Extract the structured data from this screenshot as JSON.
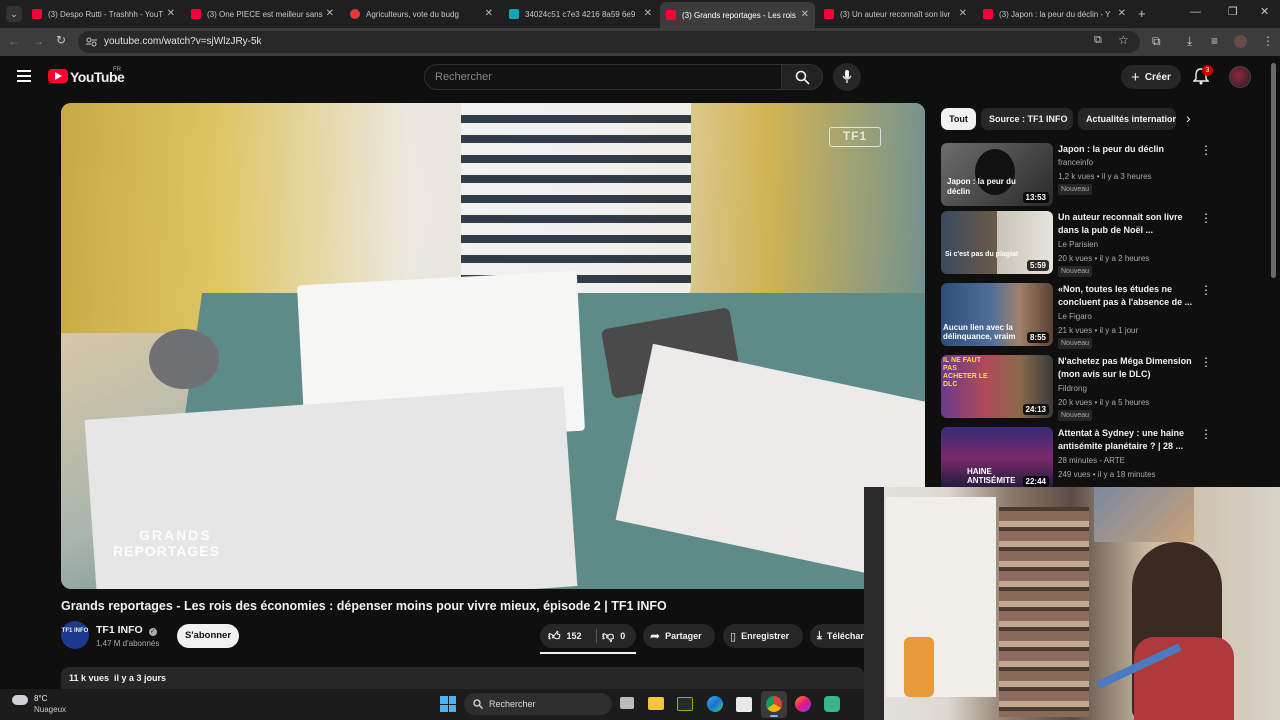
{
  "browser": {
    "tabs": [
      {
        "label": "(3) Despo Rutti - Trashhh - YouT",
        "active": false
      },
      {
        "label": "(3) One PIECE est meilleur sans",
        "active": false
      },
      {
        "label": "Agriculteurs, vote du budg",
        "active": false
      },
      {
        "label": "34024c51 c7e3 4216 8a59 6e9",
        "active": false
      },
      {
        "label": "(3) Grands reportages - Les rois",
        "active": true
      },
      {
        "label": "(3) Un auteur reconnaît son livr",
        "active": false
      },
      {
        "label": "(3) Japon : la peur du déclin - Y",
        "active": false
      }
    ],
    "url": "youtube.com/watch?v=sjWlzJRy-5k"
  },
  "header": {
    "logo": "YouTube",
    "region": "FR",
    "search_placeholder": "Rechercher",
    "create_label": "Créer",
    "notif_count": "3"
  },
  "video": {
    "watermark": "TF1",
    "overlay_line1": "GRANDS",
    "overlay_line2": "REPORTAGES",
    "title": "Grands reportages - Les rois des économies : dépenser moins pour vivre mieux, épisode 2 | TF1 INFO",
    "channel": "TF1 INFO",
    "channel_logo": "TF1 INFO",
    "subs": "1,47 M d'abonnés",
    "subscribe_label": "S'abonner",
    "likes": "152",
    "dislikes": "0",
    "share_label": "Partager",
    "save_label": "Enregistrer",
    "download_label": "Téléchar",
    "views_date": "11 k vues  il y a 3 jours"
  },
  "sidebar": {
    "chips": [
      "Tout",
      "Source : TF1 INFO",
      "Actualités internationales"
    ],
    "recs": [
      {
        "title": "Japon : la peur du déclin",
        "channel": "franceinfo",
        "meta": "1,2 k vues • il y a 3 heures",
        "badge": "Nouveau",
        "duration": "13:53",
        "thumb_text": "Japon : la peur du déclin"
      },
      {
        "title": "Un auteur reconnaît son livre dans la pub de Noël ...",
        "channel": "Le Parisien",
        "meta": "20 k vues • il y a 2 heures",
        "badge": "Nouveau",
        "duration": "5:59",
        "thumb_text": "Si c'est pas du plagiat"
      },
      {
        "title": "«Non, toutes les études ne concluent pas à l'absence de ...",
        "channel": "Le Figaro",
        "meta": "21 k vues • il y a 1 jour",
        "badge": "Nouveau",
        "duration": "8:55",
        "thumb_text": "Aucun lien avec la délinquance, vraim"
      },
      {
        "title": "N'achetez pas Méga Dimension (mon avis sur le DLC)",
        "channel": "Fildrong",
        "meta": "20 k vues • il y a 5 heures",
        "badge": "Nouveau",
        "duration": "24:13",
        "thumb_text": "IL NE FAUT PAS ACHETER LE DLC"
      },
      {
        "title": "Attentat à Sydney : une haine antisémite planétaire ? | 28 ...",
        "channel": "28 minutes - ARTE",
        "meta": "249 vues • il y a 18 minutes",
        "badge": "",
        "duration": "22:44",
        "thumb_text": "HAINE ANTISÉMITE"
      }
    ]
  },
  "taskbar": {
    "temp": "8°C",
    "weather": "Nuageux",
    "search_label": "Rechercher"
  },
  "colors": {
    "yt_red": "#ff0033",
    "bg": "#0f0f0f",
    "chip": "#272727"
  }
}
